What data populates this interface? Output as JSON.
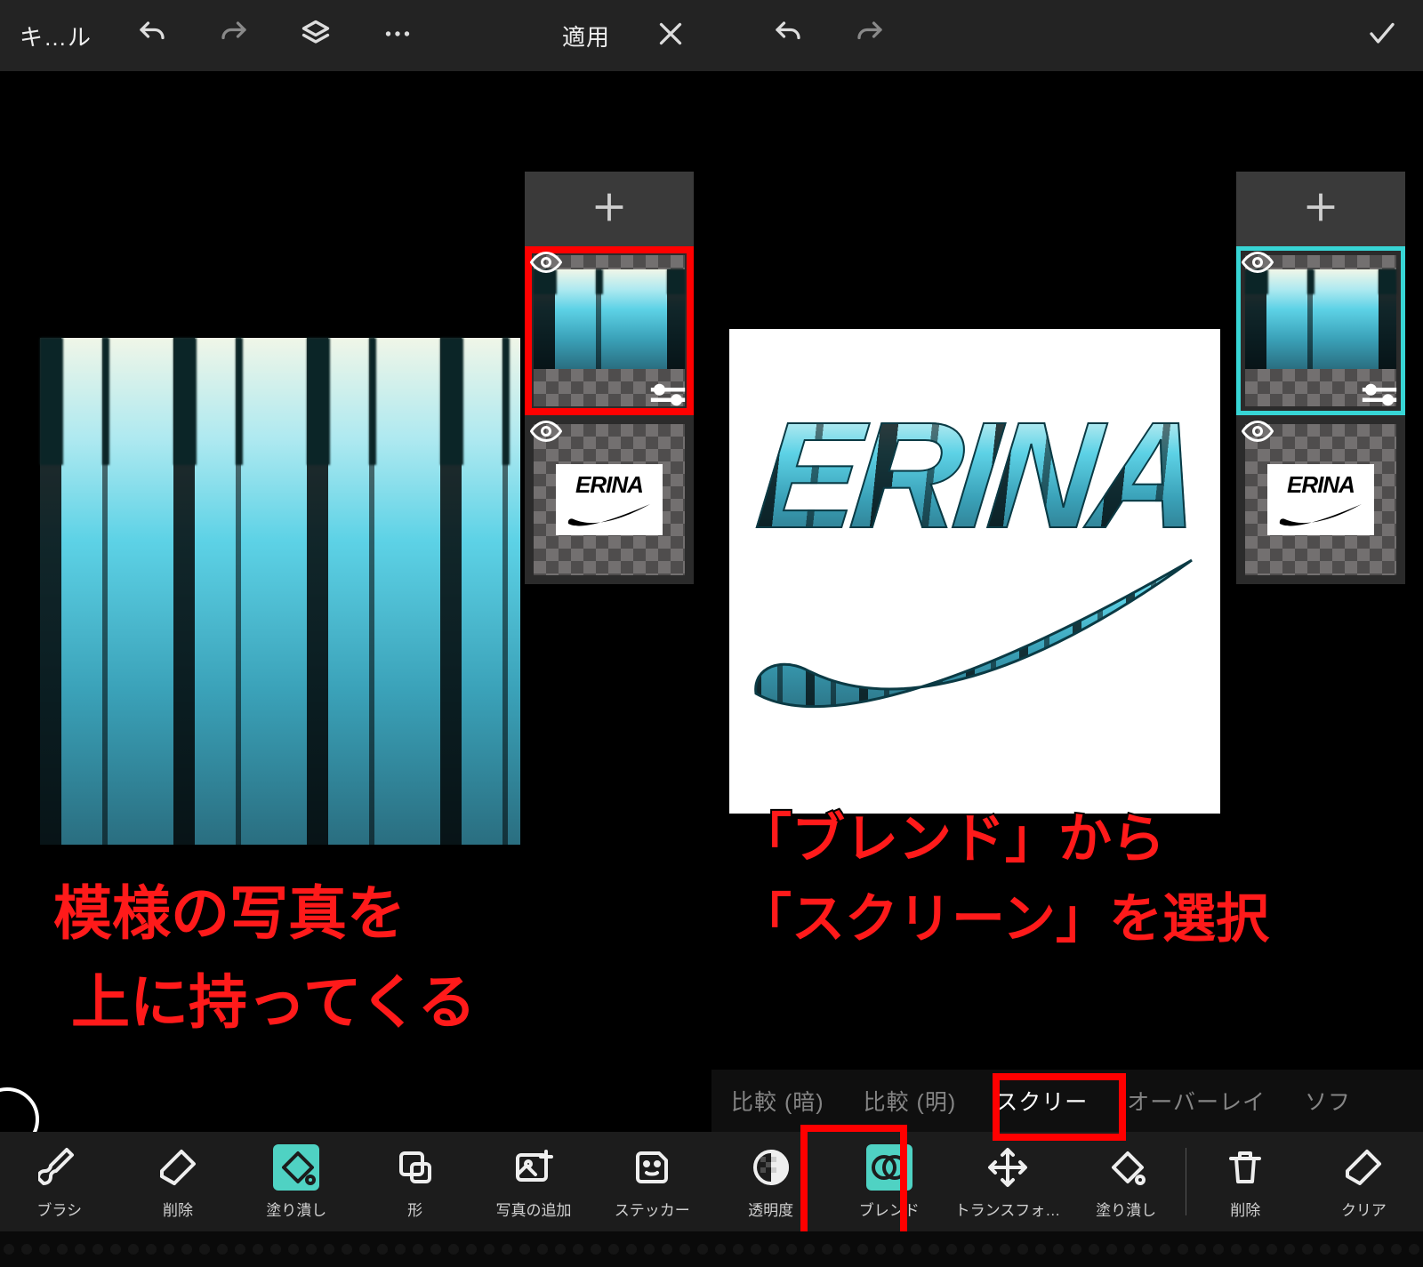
{
  "left": {
    "top": {
      "cancel_label": "キ…ル",
      "apply_label": "適用"
    },
    "layers": {
      "logo_text": "ERINA"
    },
    "annotation_line1": "模様の写真を",
    "annotation_line2": "上に持ってくる",
    "tools": [
      {
        "id": "brush",
        "label": "ブラシ"
      },
      {
        "id": "erase",
        "label": "削除"
      },
      {
        "id": "fill",
        "label": "塗り潰し",
        "active": true
      },
      {
        "id": "shape",
        "label": "形"
      },
      {
        "id": "addphoto",
        "label": "写真の追加"
      },
      {
        "id": "sticker",
        "label": "ステッカー"
      }
    ]
  },
  "right": {
    "layers": {
      "logo_text": "ERINA"
    },
    "annotation_line1": "「ブレンド」から",
    "annotation_line2": "「スクリーン」を選択",
    "blend_modes": [
      {
        "id": "darken",
        "label": "比較 (暗)"
      },
      {
        "id": "lighten",
        "label": "比較 (明)"
      },
      {
        "id": "screen",
        "label": "スクリー",
        "selected": true
      },
      {
        "id": "overlay",
        "label": "オーバーレイ"
      },
      {
        "id": "soft",
        "label": "ソフ"
      }
    ],
    "tools": [
      {
        "id": "opacity",
        "label": "透明度"
      },
      {
        "id": "blend",
        "label": "ブレンド",
        "active": true
      },
      {
        "id": "transform",
        "label": "トランスフォ…"
      },
      {
        "id": "fill",
        "label": "塗り潰し"
      },
      {
        "id": "delete",
        "label": "削除"
      },
      {
        "id": "clear",
        "label": "クリア"
      }
    ],
    "logo_text": "ERINA"
  }
}
